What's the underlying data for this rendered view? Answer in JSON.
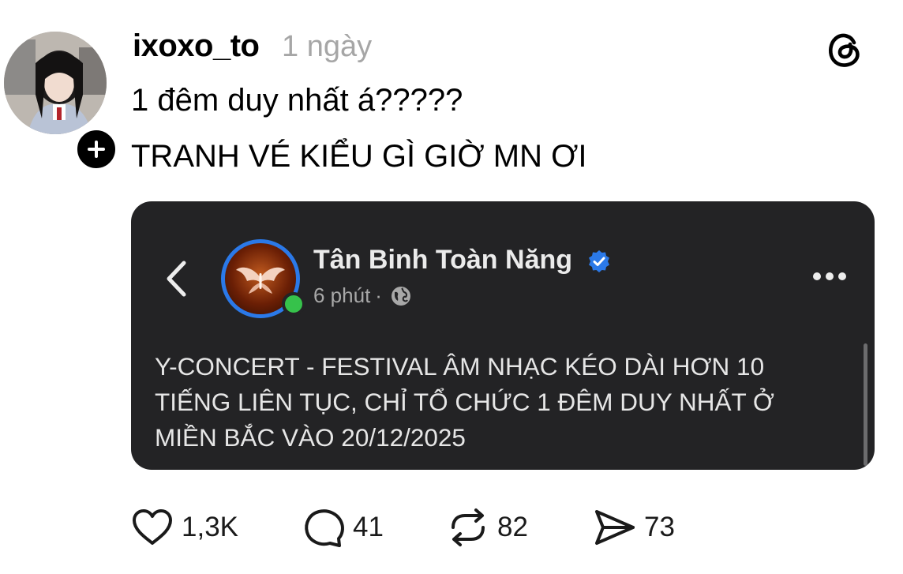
{
  "post": {
    "username": "ixoxo_to",
    "time_ago": "1 ngày",
    "line1": "1 đêm duy nhất á?????",
    "line2": "TRANH VÉ KIỂU GÌ GIỜ MN ƠI"
  },
  "embedded": {
    "page_name": "Tân Binh Toàn Năng",
    "time_ago": "6 phút",
    "separator": "·",
    "body": "Y-CONCERT -  FESTIVAL ÂM NHẠC KÉO DÀI HƠN 10\nTIẾNG LIÊN TỤC, CHỈ TỔ CHỨC 1 ĐÊM DUY NHẤT Ở\nMIỀN BẮC VÀO 20/12/2025"
  },
  "actions": {
    "likes": "1,3K",
    "comments": "41",
    "reposts": "82",
    "shares": "73"
  },
  "icons": [
    "threads-logo",
    "plus-icon",
    "chevron-left-icon",
    "verified-icon",
    "globe-icon",
    "more-icon",
    "heart-icon",
    "comment-icon",
    "repost-icon",
    "share-icon"
  ],
  "colors": {
    "verified": "#2b79e8",
    "online": "#36c24b",
    "card_bg": "#232325",
    "muted": "#a6a6a6"
  }
}
